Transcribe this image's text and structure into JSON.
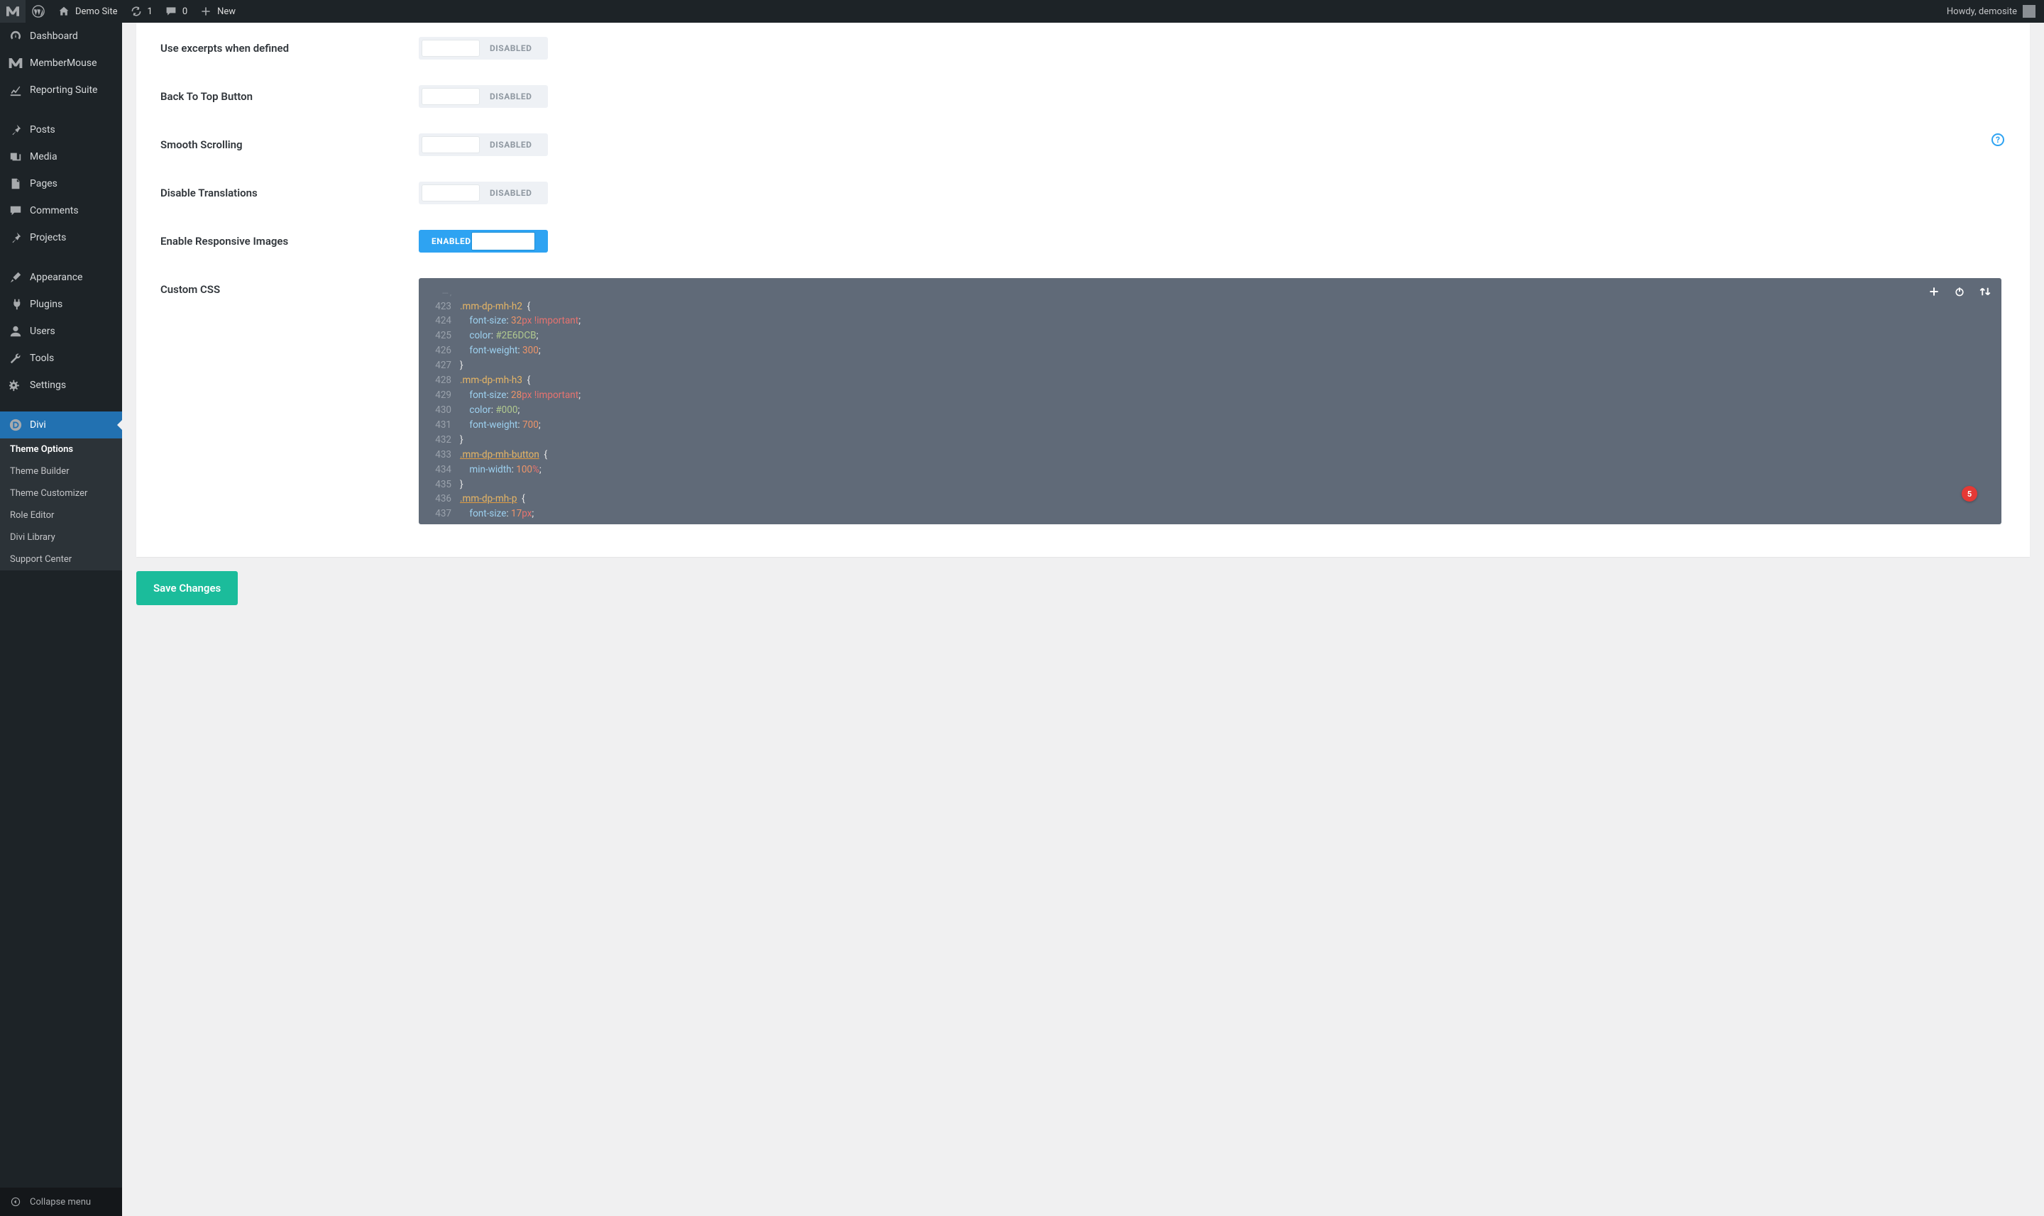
{
  "adminbar": {
    "site_name": "Demo Site",
    "updates_count": "1",
    "comments_count": "0",
    "new_label": "New",
    "howdy": "Howdy, demosite"
  },
  "sidebar": {
    "items": [
      {
        "icon": "dashboard",
        "label": "Dashboard"
      },
      {
        "icon": "mm",
        "label": "MemberMouse"
      },
      {
        "icon": "chart",
        "label": "Reporting Suite"
      },
      {
        "sep": true
      },
      {
        "icon": "pin",
        "label": "Posts"
      },
      {
        "icon": "media",
        "label": "Media"
      },
      {
        "icon": "page",
        "label": "Pages"
      },
      {
        "icon": "comment",
        "label": "Comments"
      },
      {
        "icon": "pin",
        "label": "Projects"
      },
      {
        "sep": true
      },
      {
        "icon": "brush",
        "label": "Appearance"
      },
      {
        "icon": "plug",
        "label": "Plugins"
      },
      {
        "icon": "user",
        "label": "Users"
      },
      {
        "icon": "wrench",
        "label": "Tools"
      },
      {
        "icon": "settings",
        "label": "Settings"
      },
      {
        "sep": true
      },
      {
        "icon": "divi",
        "label": "Divi",
        "active": true
      }
    ],
    "submenu": [
      {
        "label": "Theme Options",
        "current": true
      },
      {
        "label": "Theme Builder"
      },
      {
        "label": "Theme Customizer"
      },
      {
        "label": "Role Editor"
      },
      {
        "label": "Divi Library"
      },
      {
        "label": "Support Center"
      }
    ],
    "collapse_label": "Collapse menu"
  },
  "options": {
    "rows": [
      {
        "label": "Use excerpts when defined",
        "state": "disabled",
        "text": "DISABLED",
        "help": false
      },
      {
        "label": "Back To Top Button",
        "state": "disabled",
        "text": "DISABLED",
        "help": false
      },
      {
        "label": "Smooth Scrolling",
        "state": "disabled",
        "text": "DISABLED",
        "help": true
      },
      {
        "label": "Disable Translations",
        "state": "disabled",
        "text": "DISABLED",
        "help": false
      },
      {
        "label": "Enable Responsive Images",
        "state": "enabled",
        "text": "ENABLED",
        "help": false
      }
    ],
    "custom_css_label": "Custom CSS",
    "badge_count": "5"
  },
  "code": {
    "first_truncated": "--- ,",
    "lines": [
      {
        "n": "423",
        "t": [
          {
            "c": "tk-sel",
            "v": ".mm-dp-mh-h2"
          },
          {
            "c": "tk-brace",
            "v": "  {"
          }
        ]
      },
      {
        "n": "424",
        "t": [
          {
            "c": "",
            "v": "    "
          },
          {
            "c": "tk-prop",
            "v": "font-size"
          },
          {
            "c": "tk-colon",
            "v": ": "
          },
          {
            "c": "tk-num",
            "v": "32"
          },
          {
            "c": "tk-unit",
            "v": "px"
          },
          {
            "c": "",
            "v": " "
          },
          {
            "c": "tk-imp",
            "v": "!important"
          },
          {
            "c": "tk-semi",
            "v": ";"
          }
        ]
      },
      {
        "n": "425",
        "t": [
          {
            "c": "",
            "v": "    "
          },
          {
            "c": "tk-prop",
            "v": "color"
          },
          {
            "c": "tk-colon",
            "v": ": "
          },
          {
            "c": "tk-hex",
            "v": "#2E6DCB"
          },
          {
            "c": "tk-semi",
            "v": ";"
          }
        ]
      },
      {
        "n": "426",
        "t": [
          {
            "c": "",
            "v": "    "
          },
          {
            "c": "tk-prop",
            "v": "font-weight"
          },
          {
            "c": "tk-colon",
            "v": ": "
          },
          {
            "c": "tk-num",
            "v": "300"
          },
          {
            "c": "tk-semi",
            "v": ";"
          }
        ]
      },
      {
        "n": "427",
        "t": [
          {
            "c": "tk-brace",
            "v": "}"
          }
        ]
      },
      {
        "n": "428",
        "t": [
          {
            "c": "tk-sel",
            "v": ".mm-dp-mh-h3"
          },
          {
            "c": "tk-brace",
            "v": "  {"
          }
        ]
      },
      {
        "n": "429",
        "t": [
          {
            "c": "",
            "v": "    "
          },
          {
            "c": "tk-prop",
            "v": "font-size"
          },
          {
            "c": "tk-colon",
            "v": ": "
          },
          {
            "c": "tk-num",
            "v": "28"
          },
          {
            "c": "tk-unit",
            "v": "px"
          },
          {
            "c": "",
            "v": " "
          },
          {
            "c": "tk-imp",
            "v": "!important"
          },
          {
            "c": "tk-semi",
            "v": ";"
          }
        ]
      },
      {
        "n": "430",
        "t": [
          {
            "c": "",
            "v": "    "
          },
          {
            "c": "tk-prop",
            "v": "color"
          },
          {
            "c": "tk-colon",
            "v": ": "
          },
          {
            "c": "tk-hex",
            "v": "#000"
          },
          {
            "c": "tk-semi",
            "v": ";"
          }
        ]
      },
      {
        "n": "431",
        "t": [
          {
            "c": "",
            "v": "    "
          },
          {
            "c": "tk-prop",
            "v": "font-weight"
          },
          {
            "c": "tk-colon",
            "v": ": "
          },
          {
            "c": "tk-num",
            "v": "700"
          },
          {
            "c": "tk-semi",
            "v": ";"
          }
        ]
      },
      {
        "n": "432",
        "t": [
          {
            "c": "tk-brace",
            "v": "}"
          }
        ]
      },
      {
        "n": "433",
        "t": [
          {
            "c": "tk-sel ul",
            "v": ".mm-dp-mh-button"
          },
          {
            "c": "tk-brace",
            "v": "  {"
          }
        ]
      },
      {
        "n": "434",
        "t": [
          {
            "c": "",
            "v": "    "
          },
          {
            "c": "tk-prop",
            "v": "min-width"
          },
          {
            "c": "tk-colon",
            "v": ": "
          },
          {
            "c": "tk-num",
            "v": "100"
          },
          {
            "c": "tk-unit",
            "v": "%"
          },
          {
            "c": "tk-semi",
            "v": ";"
          }
        ]
      },
      {
        "n": "435",
        "t": [
          {
            "c": "tk-brace",
            "v": "}"
          }
        ]
      },
      {
        "n": "436",
        "t": [
          {
            "c": "tk-sel ul",
            "v": ".mm-dp-mh-p"
          },
          {
            "c": "tk-brace",
            "v": "  {"
          }
        ]
      },
      {
        "n": "437",
        "t": [
          {
            "c": "",
            "v": "    "
          },
          {
            "c": "tk-prop",
            "v": "font-size"
          },
          {
            "c": "tk-colon",
            "v": ": "
          },
          {
            "c": "tk-num",
            "v": "17"
          },
          {
            "c": "tk-unit",
            "v": "px"
          },
          {
            "c": "tk-semi",
            "v": ";"
          }
        ]
      }
    ]
  },
  "buttons": {
    "save_changes": "Save Changes"
  }
}
